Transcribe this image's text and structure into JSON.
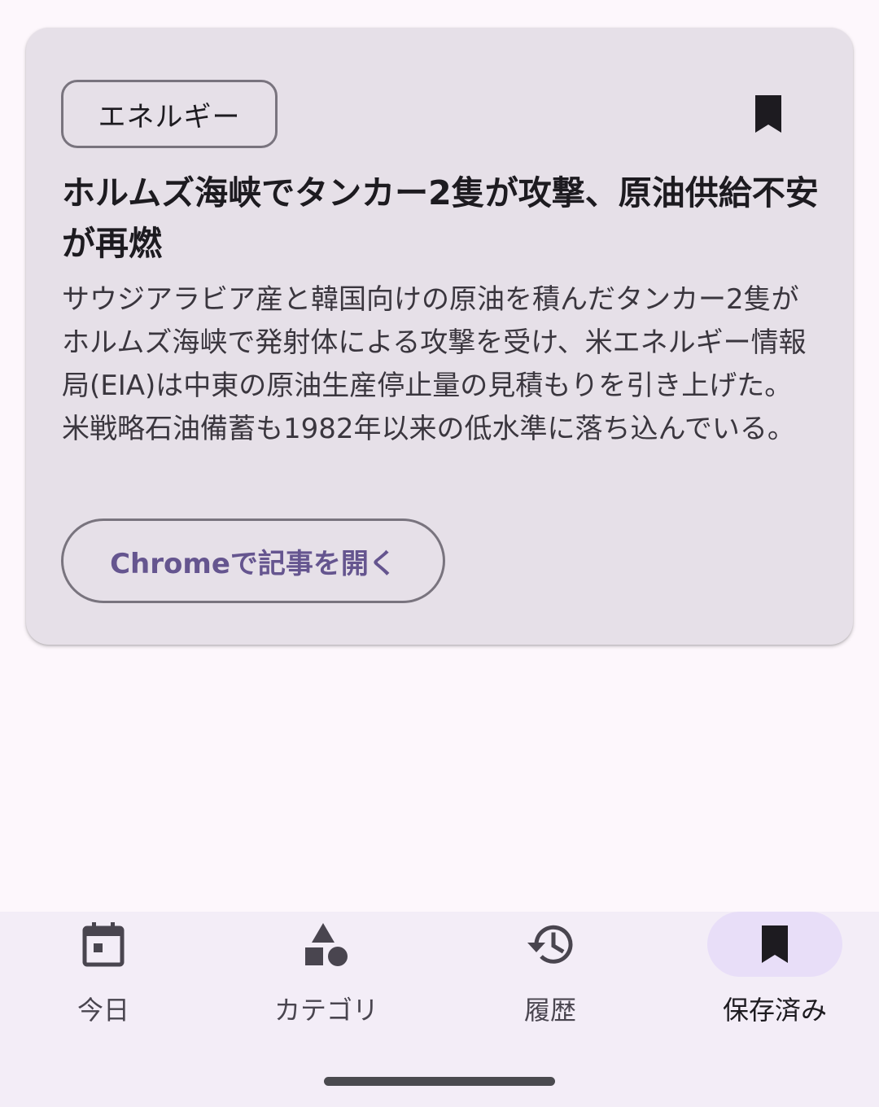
{
  "article": {
    "category": "エネルギー",
    "title": "ホルムズ海峡でタンカー2隻が攻撃、原油供給不安が再燃",
    "summary": "サウジアラビア産と韓国向けの原油を積んだタンカー2隻がホルムズ海峡で発射体による攻撃を受け、米エネルギー情報局(EIA)は中東の原油生産停止量の見積もりを引き上げた。米戦略石油備蓄も1982年以来の低水準に落ち込んでいる。",
    "open_label": "Chromeで記事を開く",
    "bookmark_icon": "bookmark-filled-icon"
  },
  "nav": {
    "items": [
      {
        "label": "今日",
        "icon": "calendar-icon",
        "active": false
      },
      {
        "label": "カテゴリ",
        "icon": "shapes-icon",
        "active": false
      },
      {
        "label": "履歴",
        "icon": "history-icon",
        "active": false
      },
      {
        "label": "保存済み",
        "icon": "bookmark-icon",
        "active": true
      }
    ]
  },
  "colors": {
    "background": "#fdf7fc",
    "card": "#e6e0e8",
    "accent": "#65558f",
    "active_indicator": "#e8def8",
    "nav_background": "#f3edf7"
  }
}
